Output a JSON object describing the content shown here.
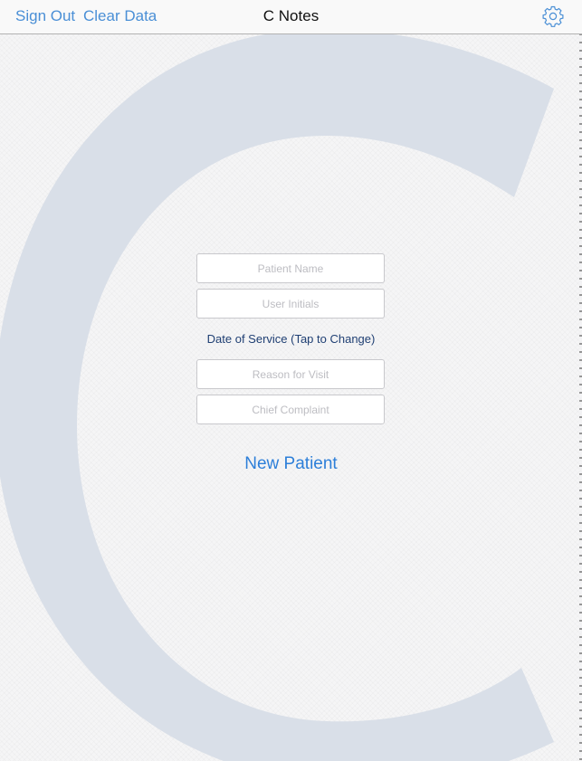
{
  "navbar": {
    "sign_out": "Sign Out",
    "clear_data": "Clear Data",
    "title": "C Notes",
    "settings_icon": "gear-icon"
  },
  "background": {
    "watermark_letter": "C",
    "watermark_color": "#d9dfe8"
  },
  "form": {
    "patient_name_placeholder": "Patient Name",
    "user_initials_placeholder": "User Initials",
    "date_of_service_label": "Date of Service (Tap to Change)",
    "reason_for_visit_placeholder": "Reason for Visit",
    "chief_complaint_placeholder": "Chief Complaint",
    "new_patient_label": "New Patient"
  },
  "colors": {
    "accent": "#4a8fd6",
    "date_label": "#1f3f73"
  }
}
